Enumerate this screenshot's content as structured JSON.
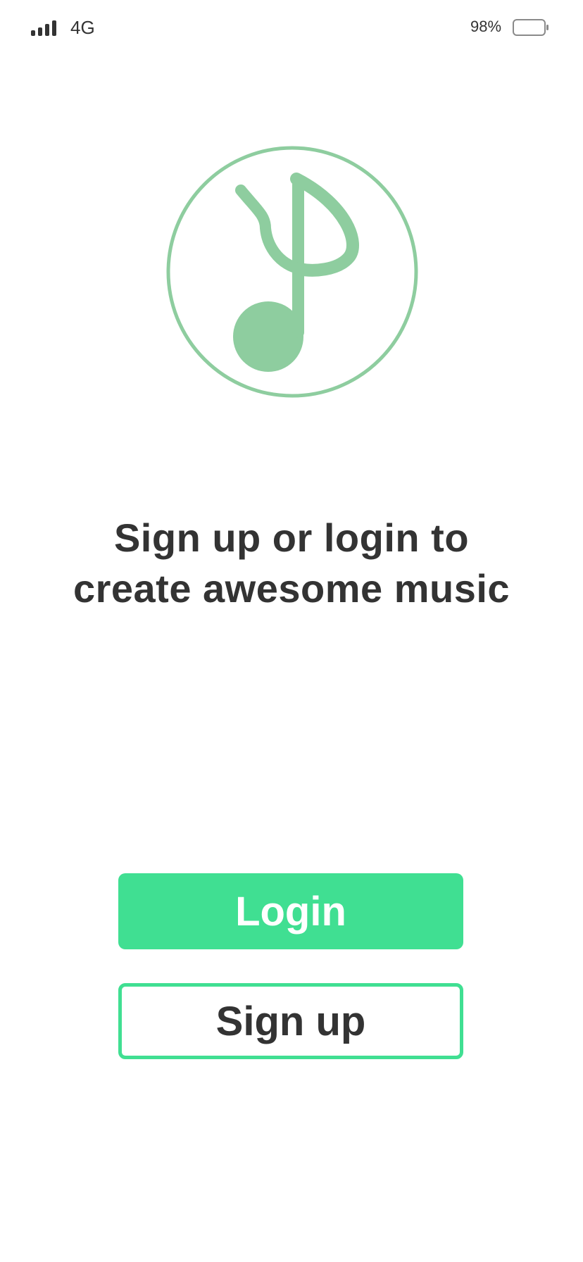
{
  "status_bar": {
    "network": "4G",
    "battery_percent": "98%",
    "battery_level": 0.98,
    "signal_icon": "signal-bars-icon",
    "battery_icon": "battery-icon"
  },
  "logo": {
    "icon": "music-note-icon",
    "color": "#8ecd9f"
  },
  "headline": {
    "line1": "Sign up or login to",
    "line2": "create awesome music"
  },
  "buttons": {
    "login_label": "Login",
    "signup_label": "Sign up"
  },
  "colors": {
    "accent": "#40df92",
    "text": "#333333",
    "logo": "#8ecd9f",
    "background": "#ffffff"
  }
}
